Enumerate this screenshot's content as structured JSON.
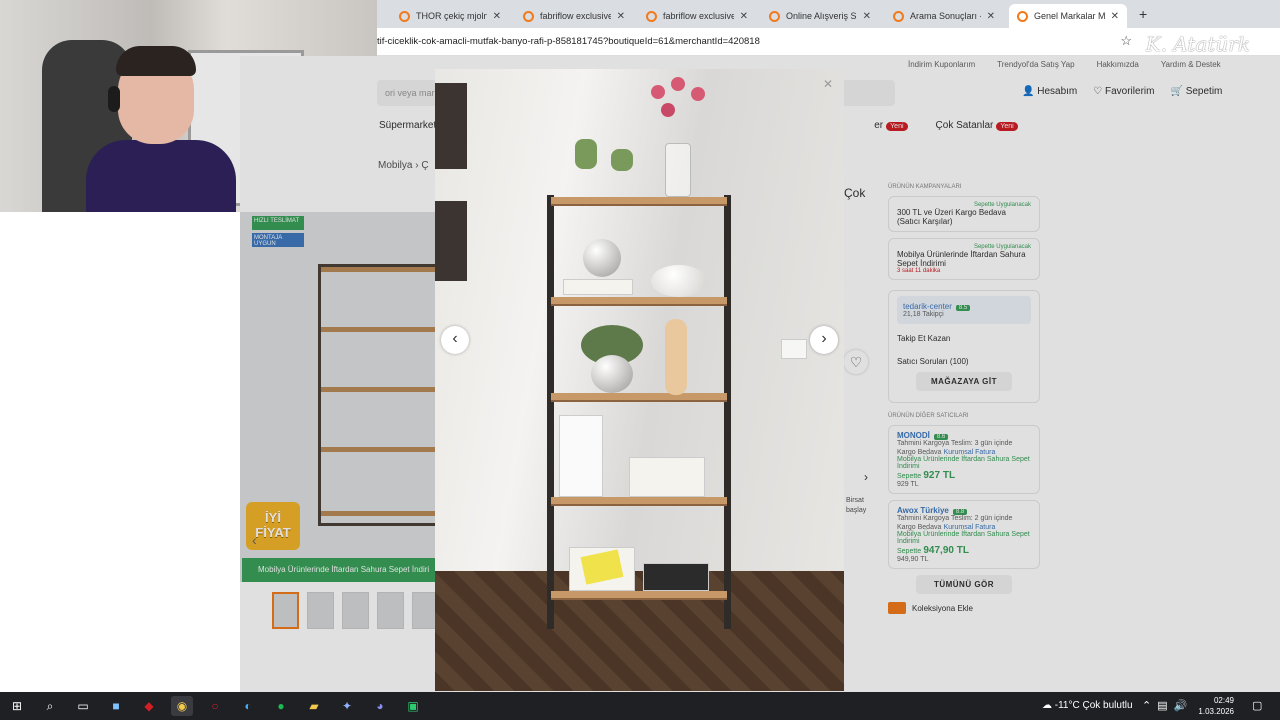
{
  "browser": {
    "tabs": [
      {
        "title": "THOR çekiç mjolnir b"
      },
      {
        "title": "fabriflow exclusive G"
      },
      {
        "title": "fabriflow exclusive G"
      },
      {
        "title": "Online Alışveriş Sitesi"
      },
      {
        "title": "Arama Sonuçları - Tre"
      },
      {
        "title": "Genel Markalar Mod"
      }
    ],
    "url": "tif-ciceklik-cok-amacli-mutfak-banyo-rafi-p-858181745?boutiqueId=61&merchantId=420818",
    "signature": "K. Atatürk"
  },
  "page": {
    "top_links": [
      "İndirim Kuponlarım",
      "Trendyol'da Satış Yap",
      "Hakkımızda",
      "Yardım & Destek"
    ],
    "search_placeholder": "ori veya marka",
    "account": {
      "login": "Hesabım",
      "favorites": "Favorilerim",
      "cart": "Sepetim"
    },
    "categories": [
      "Süpermarket",
      "er",
      "Çok Satanlar"
    ],
    "new_badge": "Yeni",
    "breadcrumb": "Mobilya  ›  Ç",
    "title_fragment": "Çok",
    "gallery": {
      "fast_label": "HIZLI TESLİMAT",
      "mount_label": "MONTAJA UYGUN",
      "good_price": "İYİ FİYAT",
      "promo": "Mobilya Ürünlerinde İftardan Sahura Sepet İndiri"
    },
    "partial_texts": [
      "Birsat",
      "başlay"
    ],
    "right": {
      "campaigns_header": "ÜRÜNÜN KAMPANYALARI",
      "campaigns": [
        {
          "tag": "Sepette Uygulanacak",
          "text": "300 TL ve Üzeri Kargo Bedava (Satıcı Karşılar)"
        },
        {
          "tag": "Sepette Uygulanacak",
          "text": "Mobilya Ürünlerinde İftardan Sahura Sepet İndirimi",
          "timer": "3 saat 11 dakika"
        }
      ],
      "seller": {
        "name": "tedarik-center",
        "score": "8.5",
        "followers": "21,18 Takipçi"
      },
      "follow": "Takip Et Kazan",
      "questions": "Satıcı Soruları (100)",
      "store_button": "MAĞAZAYA GİT",
      "other_sellers_header": "ÜRÜNÜN DİĞER SATICILARI",
      "other_sellers": [
        {
          "name": "MONODİ",
          "score": "8.6",
          "delivery": "Tahmini Kargoya Teslim: 3 gün içinde",
          "free": "Kargo Bedava",
          "invoice": "Kurumsal Fatura",
          "promo": "Mobilya Ürünlerinde İftardan Sahura Sepet İndirimi",
          "basket": "Sepette",
          "basket_price": "927 TL",
          "price": "929 TL"
        },
        {
          "name": "Awox Türkiye",
          "score": "8.8",
          "delivery": "Tahmini Kargoya Teslim: 2 gün içinde",
          "free": "Kargo Bedava",
          "invoice": "Kurumsal Fatura",
          "promo": "Mobilya Ürünlerinde İftardan Sahura Sepet İndirimi",
          "basket": "Sepette",
          "basket_price": "947,90 TL",
          "price": "949,90 TL"
        }
      ],
      "see_all": "TÜMÜNÜ GÖR",
      "collection": "Koleksiyona Ekle"
    }
  },
  "taskbar": {
    "weather": "-11°C  Çok bulutlu",
    "time": "02:49",
    "date": "1.03.2026"
  },
  "colors": {
    "accent": "#f27a1a",
    "green": "#3aa15b",
    "blue": "#3f79bf",
    "red": "#d21f26"
  }
}
